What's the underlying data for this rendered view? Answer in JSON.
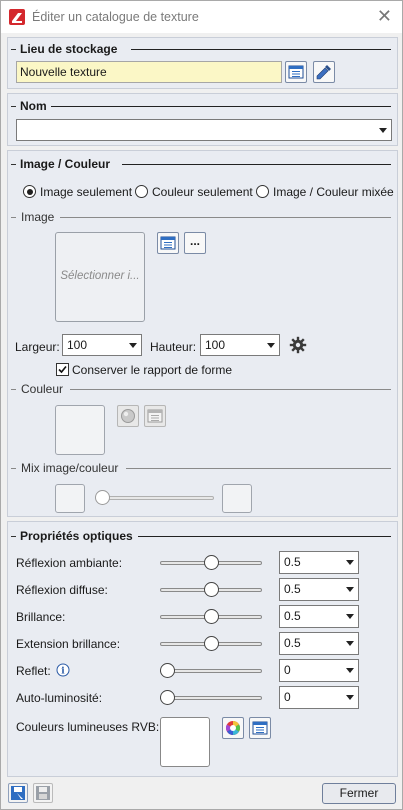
{
  "window": {
    "title": "Éditer un catalogue de texture",
    "close_glyph": "✕"
  },
  "storage": {
    "title": "Lieu de stockage",
    "value": "Nouvelle texture"
  },
  "name": {
    "title": "Nom",
    "value": ""
  },
  "image_color": {
    "title": "Image / Couleur",
    "radios": [
      {
        "label": "Image seulement",
        "selected": true
      },
      {
        "label": "Couleur seulement",
        "selected": false
      },
      {
        "label": "Image / Couleur mixée",
        "selected": false
      }
    ],
    "image_group": "Image",
    "image_placeholder": "Sélectionner i...",
    "browse_label": "...",
    "width_label": "Largeur:",
    "width_value": "100",
    "height_label": "Hauteur:",
    "height_value": "100",
    "keep_ratio_label": "Conserver le rapport de forme",
    "keep_ratio_checked": true,
    "color_group": "Couleur",
    "mix_group": "Mix image/couleur",
    "mix_level": 0.0
  },
  "optical": {
    "title": "Propriétés optiques",
    "rows": [
      {
        "label": "Réflexion ambiante:",
        "value": "0.5",
        "slider": 0.5
      },
      {
        "label": "Réflexion diffuse:",
        "value": "0.5",
        "slider": 0.5
      },
      {
        "label": "Brillance:",
        "value": "0.5",
        "slider": 0.5
      },
      {
        "label": "Extension brillance:",
        "value": "0.5",
        "slider": 0.5
      },
      {
        "label": "Reflet:",
        "value": "0",
        "slider": 0.0
      },
      {
        "label": "Auto-luminosité:",
        "value": "0",
        "slider": 0.0
      }
    ],
    "info_glyph": "i",
    "rgb_label": "Couleurs lumineuses RVB:"
  },
  "footer": {
    "close_label": "Fermer"
  },
  "colors": {
    "accent_red": "#d4282d",
    "input_yellow": "#fbf7c6",
    "panel_bg": "#e9ecf2"
  }
}
